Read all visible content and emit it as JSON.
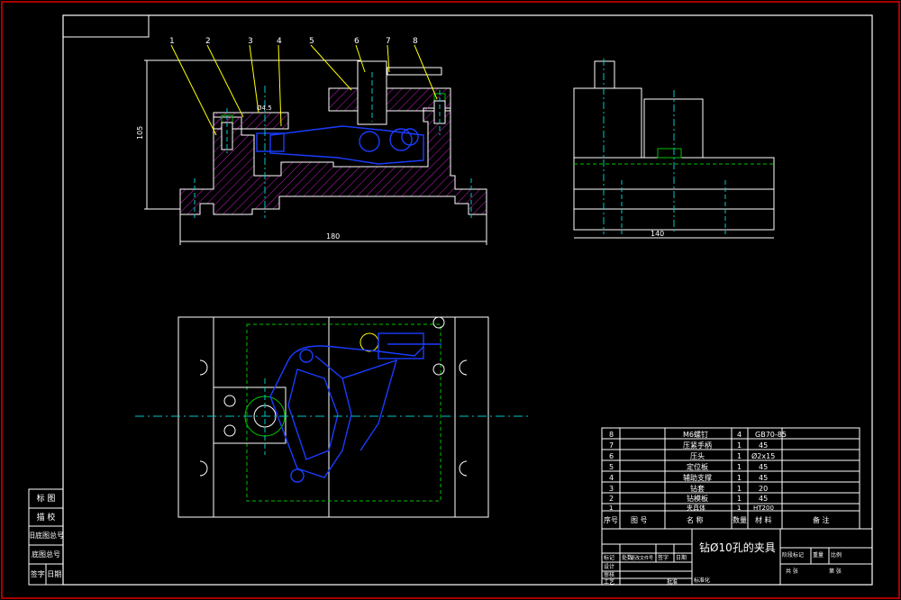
{
  "drawing": {
    "title": "钻Ø10孔的夹具",
    "dimensions": {
      "front_height": "105",
      "front_width": "180",
      "side_width": "140",
      "hole_note": "Ø10",
      "hole_note2": "Ø4.5"
    },
    "balloons": [
      "1",
      "2",
      "3",
      "4",
      "5",
      "6",
      "7",
      "8"
    ],
    "bom_header": {
      "no": "序号",
      "code": "图 号",
      "name": "名 称",
      "qty": "数量",
      "material": "材 料",
      "remark": "备 注"
    },
    "bom": [
      {
        "no": "8",
        "name": "M6螺钉",
        "qty": "4",
        "material": "GB70-85"
      },
      {
        "no": "7",
        "name": "压紧手柄",
        "qty": "1",
        "material": "45"
      },
      {
        "no": "6",
        "name": "压头",
        "qty": "1",
        "material": "Ø2x15"
      },
      {
        "no": "5",
        "name": "定位板",
        "qty": "1",
        "material": "45"
      },
      {
        "no": "4",
        "name": "辅助支撑",
        "qty": "1",
        "material": "45"
      },
      {
        "no": "3",
        "name": "钻套",
        "qty": "1",
        "material": "20"
      },
      {
        "no": "2",
        "name": "钻模板",
        "qty": "1",
        "material": "45"
      },
      {
        "no": "1",
        "name": "夹具体",
        "qty": "1",
        "material": "HT200"
      }
    ],
    "left_block": [
      "标 图",
      "描 校",
      "旧底图总号",
      "底图总号",
      "签字 日期"
    ],
    "title_small": [
      "标记",
      "处数",
      "更改文件号",
      "签字",
      "日期",
      "设计",
      "审核",
      "工艺",
      "标准化",
      "阶段标记",
      "重量",
      "比例",
      "共 张",
      "第 张",
      "批准"
    ]
  }
}
